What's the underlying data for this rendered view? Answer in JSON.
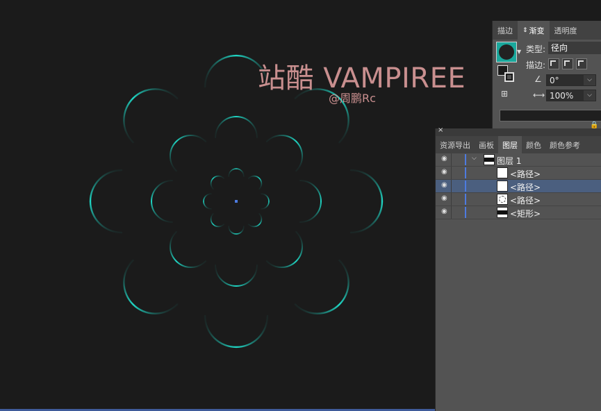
{
  "watermark": {
    "title": "站酷 VAMPIREE",
    "subtitle": "@周鹏Rc"
  },
  "colors": {
    "canvas_bg": "#1b1b1b",
    "arc_stroke": "#1fd6c4",
    "center_point": "#4d7be0",
    "watermark": "#c98f8f",
    "selected_row": "#4b5f7f"
  },
  "gradient_panel": {
    "tabs": [
      {
        "label": "描边",
        "active": false
      },
      {
        "label": "渐变",
        "active": true
      },
      {
        "label": "透明度",
        "active": false
      }
    ],
    "tab_swap_icon": "⇕",
    "type_label": "类型:",
    "type_value": "径向",
    "stroke_label": "描边:",
    "angle_value": "0°",
    "aspect_value": "100%",
    "dropdown_icon": "⌵",
    "lock_icon": "🔒"
  },
  "layers_panel": {
    "close_icon": "×",
    "tabs": [
      {
        "label": "资源导出",
        "active": false
      },
      {
        "label": "画板",
        "active": false
      },
      {
        "label": "图层",
        "active": true
      },
      {
        "label": "颜色",
        "active": false
      },
      {
        "label": "颜色参考",
        "active": false
      }
    ],
    "rows": [
      {
        "label": "图层 1",
        "kind": "layer",
        "selected": false
      },
      {
        "label": "<路径>",
        "kind": "path",
        "selected": false
      },
      {
        "label": "<路径>",
        "kind": "path",
        "selected": true
      },
      {
        "label": "<路径>",
        "kind": "dashed",
        "selected": false
      },
      {
        "label": "<矩形>",
        "kind": "rect",
        "selected": false
      }
    ],
    "eye_icon": "👁",
    "expand_icon": "⌵"
  }
}
